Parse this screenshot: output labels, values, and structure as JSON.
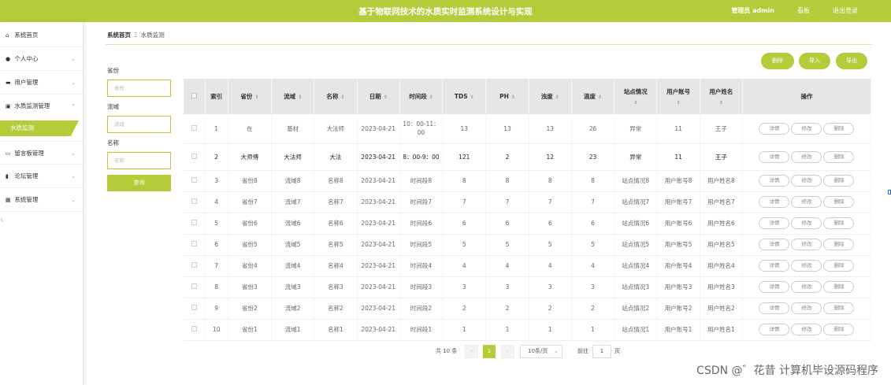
{
  "header": {
    "title": "基于物联网技术的水质实时监测系统设计与实现",
    "admin": "管理员 admin",
    "nav_board": "看板",
    "nav_logout": "退出登录"
  },
  "sidebar": {
    "items": [
      {
        "icon": "⌂",
        "label": "系统首页"
      },
      {
        "icon": "●",
        "label": "个人中心"
      },
      {
        "icon": "▬",
        "label": "用户管理"
      },
      {
        "icon": "▣",
        "label": "水质监测管理"
      },
      {
        "icon": "▭",
        "label": "留言板管理"
      },
      {
        "icon": "▮",
        "label": "论坛管理"
      },
      {
        "icon": "▦",
        "label": "系统管理"
      }
    ],
    "sub_active": "水质监测"
  },
  "breadcrumb": {
    "home": "系统首页",
    "sep": "Ξ",
    "current": "水质监测"
  },
  "filters": {
    "province_label": "省份",
    "province_placeholder": "省份",
    "basin_label": "流域",
    "basin_placeholder": "流域",
    "name_label": "名称",
    "name_placeholder": "名称",
    "search_btn": "查询"
  },
  "actions": {
    "delete": "删除",
    "import": "导入",
    "export": "导出"
  },
  "table": {
    "headers": [
      "索引",
      "省份",
      "流域",
      "名称",
      "日期",
      "时间段",
      "TDS",
      "PH",
      "浊度",
      "温度",
      "站点情况",
      "用户账号",
      "用户姓名",
      "操作"
    ],
    "rows": [
      [
        "1",
        "在",
        "基材",
        "大法师",
        "2023-04-21",
        "10：00-11：00",
        "13",
        "13",
        "13",
        "26",
        "异常",
        "11",
        "王子"
      ],
      [
        "2",
        "大师傅",
        "大法师",
        "大法",
        "2023-04-21",
        "8：00-9：00",
        "121",
        "2",
        "12",
        "23",
        "异常",
        "11",
        "王子"
      ],
      [
        "3",
        "省份8",
        "流域8",
        "名称8",
        "2023-04-21",
        "时间段8",
        "8",
        "8",
        "8",
        "8",
        "站点情况8",
        "用户账号8",
        "用户姓名8"
      ],
      [
        "4",
        "省份7",
        "流域7",
        "名称7",
        "2023-04-21",
        "时间段7",
        "7",
        "7",
        "7",
        "7",
        "站点情况7",
        "用户账号7",
        "用户姓名7"
      ],
      [
        "5",
        "省份6",
        "流域6",
        "名称6",
        "2023-04-21",
        "时间段6",
        "6",
        "6",
        "6",
        "6",
        "站点情况6",
        "用户账号6",
        "用户姓名6"
      ],
      [
        "6",
        "省份5",
        "流域5",
        "名称5",
        "2023-04-21",
        "时间段5",
        "5",
        "5",
        "5",
        "5",
        "站点情况5",
        "用户账号5",
        "用户姓名5"
      ],
      [
        "7",
        "省份4",
        "流域4",
        "名称4",
        "2023-04-21",
        "时间段4",
        "4",
        "4",
        "4",
        "4",
        "站点情况4",
        "用户账号4",
        "用户姓名4"
      ],
      [
        "8",
        "省份3",
        "流域3",
        "名称3",
        "2023-04-21",
        "时间段3",
        "3",
        "3",
        "3",
        "3",
        "站点情况3",
        "用户账号3",
        "用户姓名3"
      ],
      [
        "9",
        "省份2",
        "流域2",
        "名称2",
        "2023-04-21",
        "时间段2",
        "2",
        "2",
        "2",
        "2",
        "站点情况2",
        "用户账号2",
        "用户姓名2"
      ],
      [
        "10",
        "省份1",
        "流域1",
        "名称1",
        "2023-04-21",
        "时间段1",
        "1",
        "1",
        "1",
        "1",
        "站点情况1",
        "用户账号1",
        "用户姓名1"
      ]
    ],
    "row_buttons": [
      "详情",
      "修改",
      "删除"
    ]
  },
  "pagination": {
    "total": "共 10 条",
    "prev": "‹",
    "current_page": "1",
    "next": "›",
    "page_size": "10条/页",
    "goto_label": "前往",
    "goto_value": "1",
    "page_suffix": "页"
  },
  "watermark": "CSDN @゛花昔 计算机毕设源码程序",
  "colors": {
    "accent": "#b5cb3a"
  }
}
